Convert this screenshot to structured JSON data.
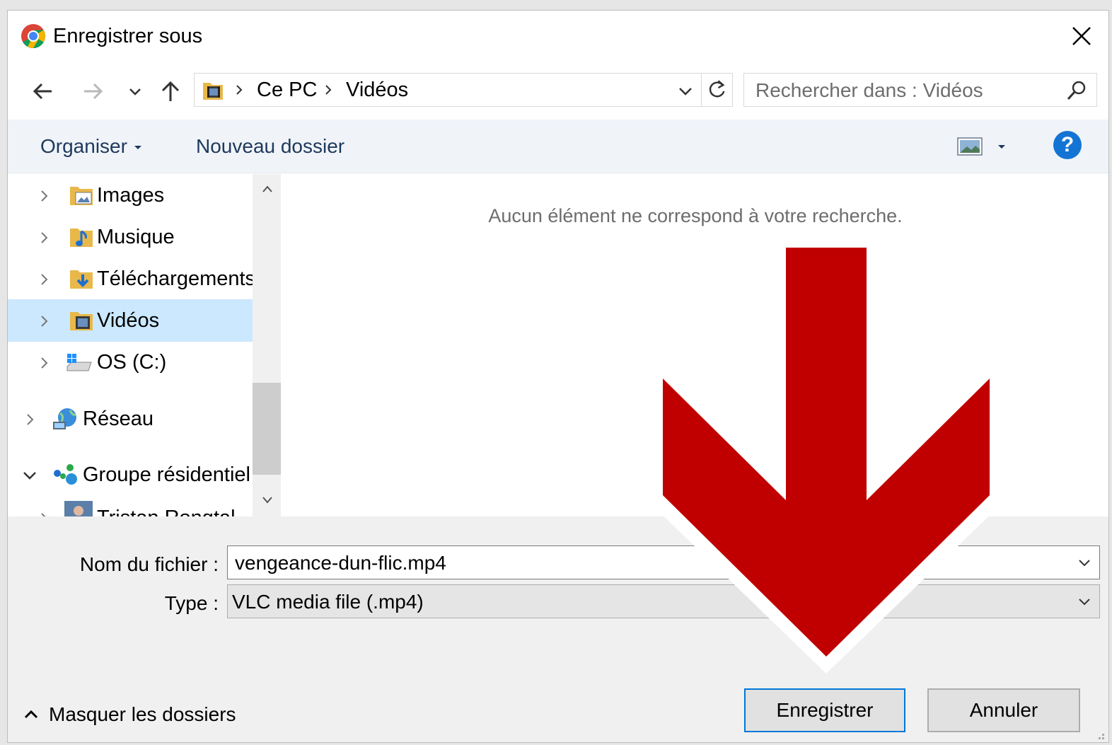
{
  "window": {
    "title": "Enregistrer sous",
    "app_icon": "chrome-icon",
    "close_icon": "close-icon"
  },
  "nav": {
    "back_icon": "back-arrow-icon",
    "forward_icon": "forward-arrow-icon",
    "recent_icon": "chevron-down-icon",
    "up_icon": "up-arrow-icon",
    "breadcrumb": [
      "Ce PC",
      "Vidéos"
    ],
    "refresh_icon": "refresh-icon",
    "search_placeholder": "Rechercher dans : Vidéos",
    "search_icon": "search-icon"
  },
  "toolbar": {
    "organize_label": "Organiser",
    "new_folder_label": "Nouveau dossier",
    "view_icon": "view-icon",
    "help_label": "?"
  },
  "tree": {
    "items": [
      {
        "label": "Images",
        "icon": "pictures-folder-icon",
        "expanded": false,
        "selected": false
      },
      {
        "label": "Musique",
        "icon": "music-folder-icon",
        "expanded": false,
        "selected": false
      },
      {
        "label": "Téléchargements",
        "icon": "downloads-folder-icon",
        "expanded": false,
        "selected": true
      },
      {
        "label": "Vidéos",
        "icon": "videos-folder-icon",
        "expanded": false,
        "selected": true
      },
      {
        "label": "OS (C:)",
        "icon": "drive-icon",
        "expanded": false,
        "selected": false
      },
      {
        "label": "Réseau",
        "icon": "network-icon",
        "expanded": false,
        "selected": false
      },
      {
        "label": "Groupe résidentiel",
        "icon": "homegroup-icon",
        "expanded": true,
        "selected": false
      },
      {
        "label": "Tristan Rongtal",
        "icon": "user-avatar-icon",
        "expanded": false,
        "selected": false
      }
    ]
  },
  "content": {
    "empty_message": "Aucun élément ne correspond à votre recherche."
  },
  "form": {
    "filename_label": "Nom du fichier :",
    "filename_value": "vengeance-dun-flic.mp4",
    "type_label": "Type :",
    "type_value": "VLC media file (.mp4)"
  },
  "footer": {
    "hide_folders_label": "Masquer les dossiers",
    "save_label": "Enregistrer",
    "cancel_label": "Annuler"
  },
  "colors": {
    "accent": "#0078d7",
    "selection": "#cce8ff",
    "toolbar_text": "#1e395b",
    "annotation_arrow": "#c00000"
  }
}
